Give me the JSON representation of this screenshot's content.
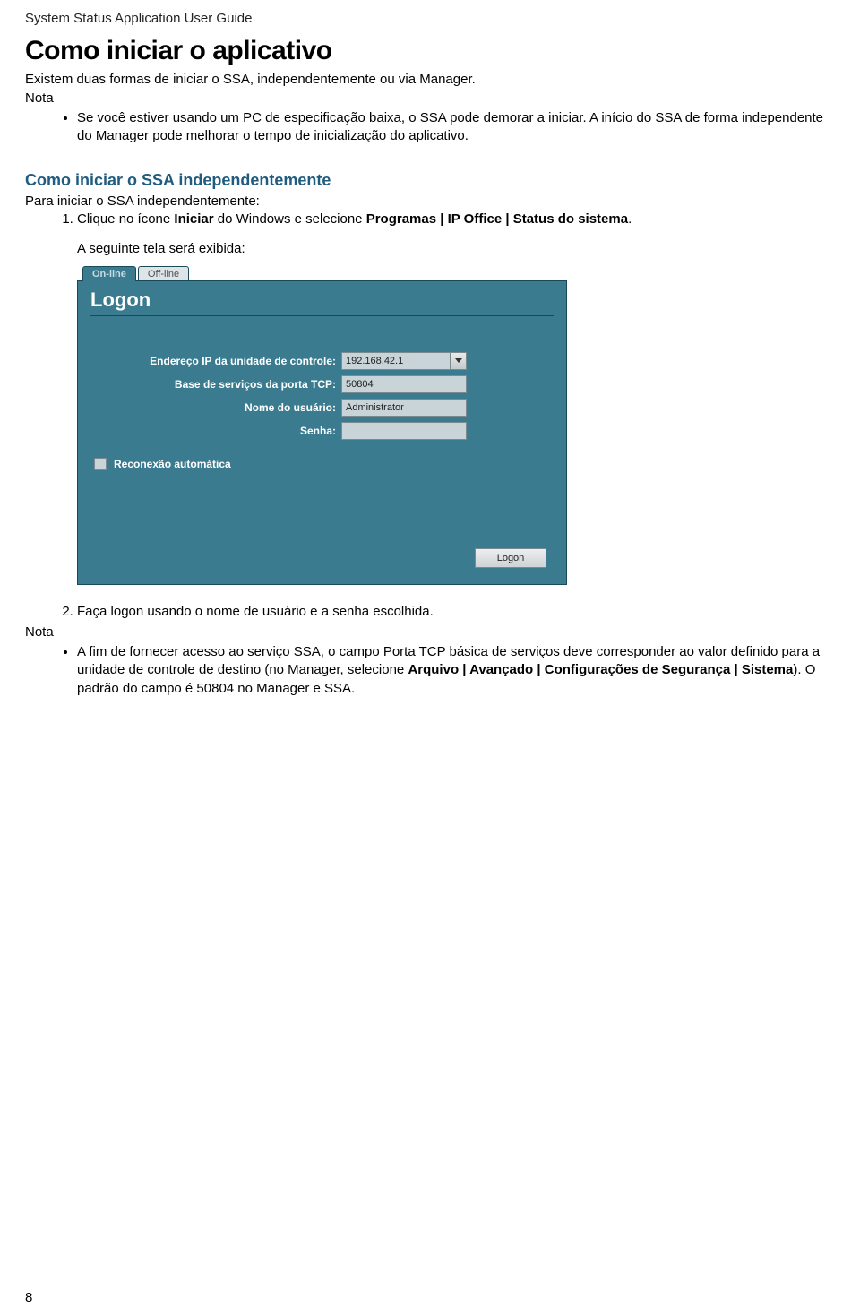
{
  "header": {
    "doc_title": "System Status Application User Guide"
  },
  "title": "Como iniciar o aplicativo",
  "intro": "Existem duas formas de iniciar o SSA, independentemente ou via Manager.",
  "nota_label": "Nota",
  "note1": "Se você estiver usando um PC de especificação baixa, o SSA pode demorar a iniciar. A início do SSA de forma independente do Manager pode melhorar o tempo de inicialização do aplicativo.",
  "section_title": "Como iniciar o SSA independentemente",
  "section_intro": "Para iniciar o SSA independentemente:",
  "step1_prefix": "Clique no ícone ",
  "step1_b1": "Iniciar",
  "step1_mid1": " do Windows e selecione ",
  "step1_b2": "Programas | IP Office | Status do sistema",
  "step1_suffix": ".",
  "screen_label": "A seguinte tela será exibida:",
  "logon": {
    "tab_online": "On-line",
    "tab_offline": "Off-line",
    "title": "Logon",
    "ip_label": "Endereço IP da unidade de controle:",
    "ip_value": "192.168.42.1",
    "port_label": "Base de serviços da porta TCP:",
    "port_value": "50804",
    "user_label": "Nome do usuário:",
    "user_value": "Administrator",
    "pwd_label": "Senha:",
    "pwd_value": "",
    "reconnect_label": "Reconexão automática",
    "logon_btn": "Logon"
  },
  "step2": "Faça logon usando o nome de usuário e a senha escolhida.",
  "note2_pre": "A fim de fornecer acesso ao serviço SSA, o campo Porta TCP básica de serviços deve corresponder ao valor definido para a unidade de controle de destino (no Manager, selecione ",
  "note2_bold": "Arquivo | Avançado | Configurações de Segurança | Sistema",
  "note2_post": "). O padrão do campo é 50804 no Manager e SSA.",
  "footer": {
    "page": "8"
  }
}
